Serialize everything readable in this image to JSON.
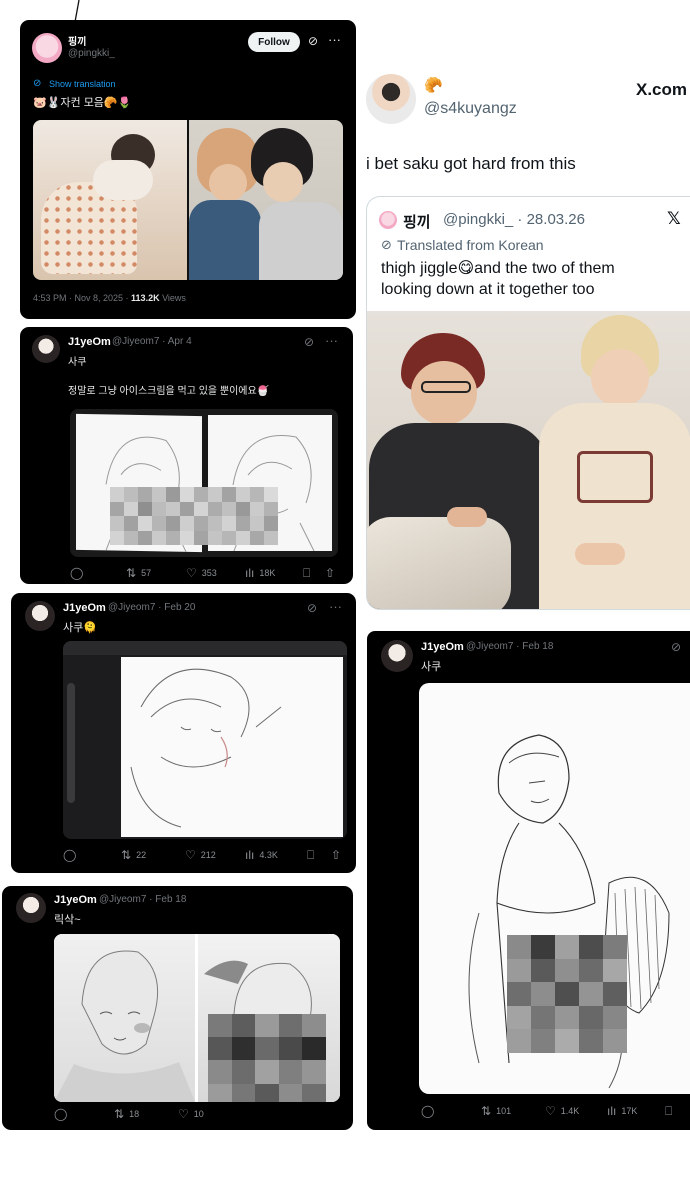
{
  "tweet1": {
    "name": "핑끼",
    "handle": "@pingkki_",
    "follow": "Follow",
    "translate": "Show translation",
    "text": "🐷🐰자컨 모음🥐🌷",
    "time": "4:53 PM · Nov 8, 2025 · ",
    "views_count": "113.2K",
    "views_label": " Views"
  },
  "tweet2": {
    "name": "J1yeOm",
    "handle": "@Jiyeom7 · Apr 4",
    "line1": "사쿠",
    "line2": "정말로 그냥 아이스크림을 먹고 있을 뿐이에요🍧",
    "replies": "",
    "reposts": "57",
    "likes": "353",
    "views": "18K"
  },
  "tweet3": {
    "name": "J1yeOm",
    "handle": "@Jiyeom7 · Feb 20",
    "line1": "사쿠🫠",
    "reposts": "22",
    "likes": "212",
    "views": "4.3K"
  },
  "tweet4": {
    "name": "J1yeOm",
    "handle": "@Jiyeom7 · Feb 18",
    "line1": "릭삭~",
    "reposts": "18",
    "likes": "10"
  },
  "tweet5": {
    "name": "J1yeOm",
    "handle": "@Jiyeom7 · Feb 18",
    "line1": "사쿠",
    "reposts": "101",
    "likes": "1.4K",
    "views": "17K"
  },
  "reply": {
    "emoji": "🥐",
    "handle": "@s4kuyangz",
    "site": "X.com",
    "text": "i bet saku got hard from this",
    "quote": {
      "name": "핑끼",
      "handle": "@pingkki_ · 28.03.26",
      "xmark": "𝕏",
      "translated": "Translated from Korean",
      "line1": "thigh jiggle😋and the two of them",
      "line2": "looking down at it together too"
    }
  },
  "icons": {
    "reply": "reply-icon",
    "repost": "repost-icon",
    "like": "heart-icon",
    "views": "views-icon",
    "bookmark": "bookmark-icon",
    "share": "share-icon"
  }
}
